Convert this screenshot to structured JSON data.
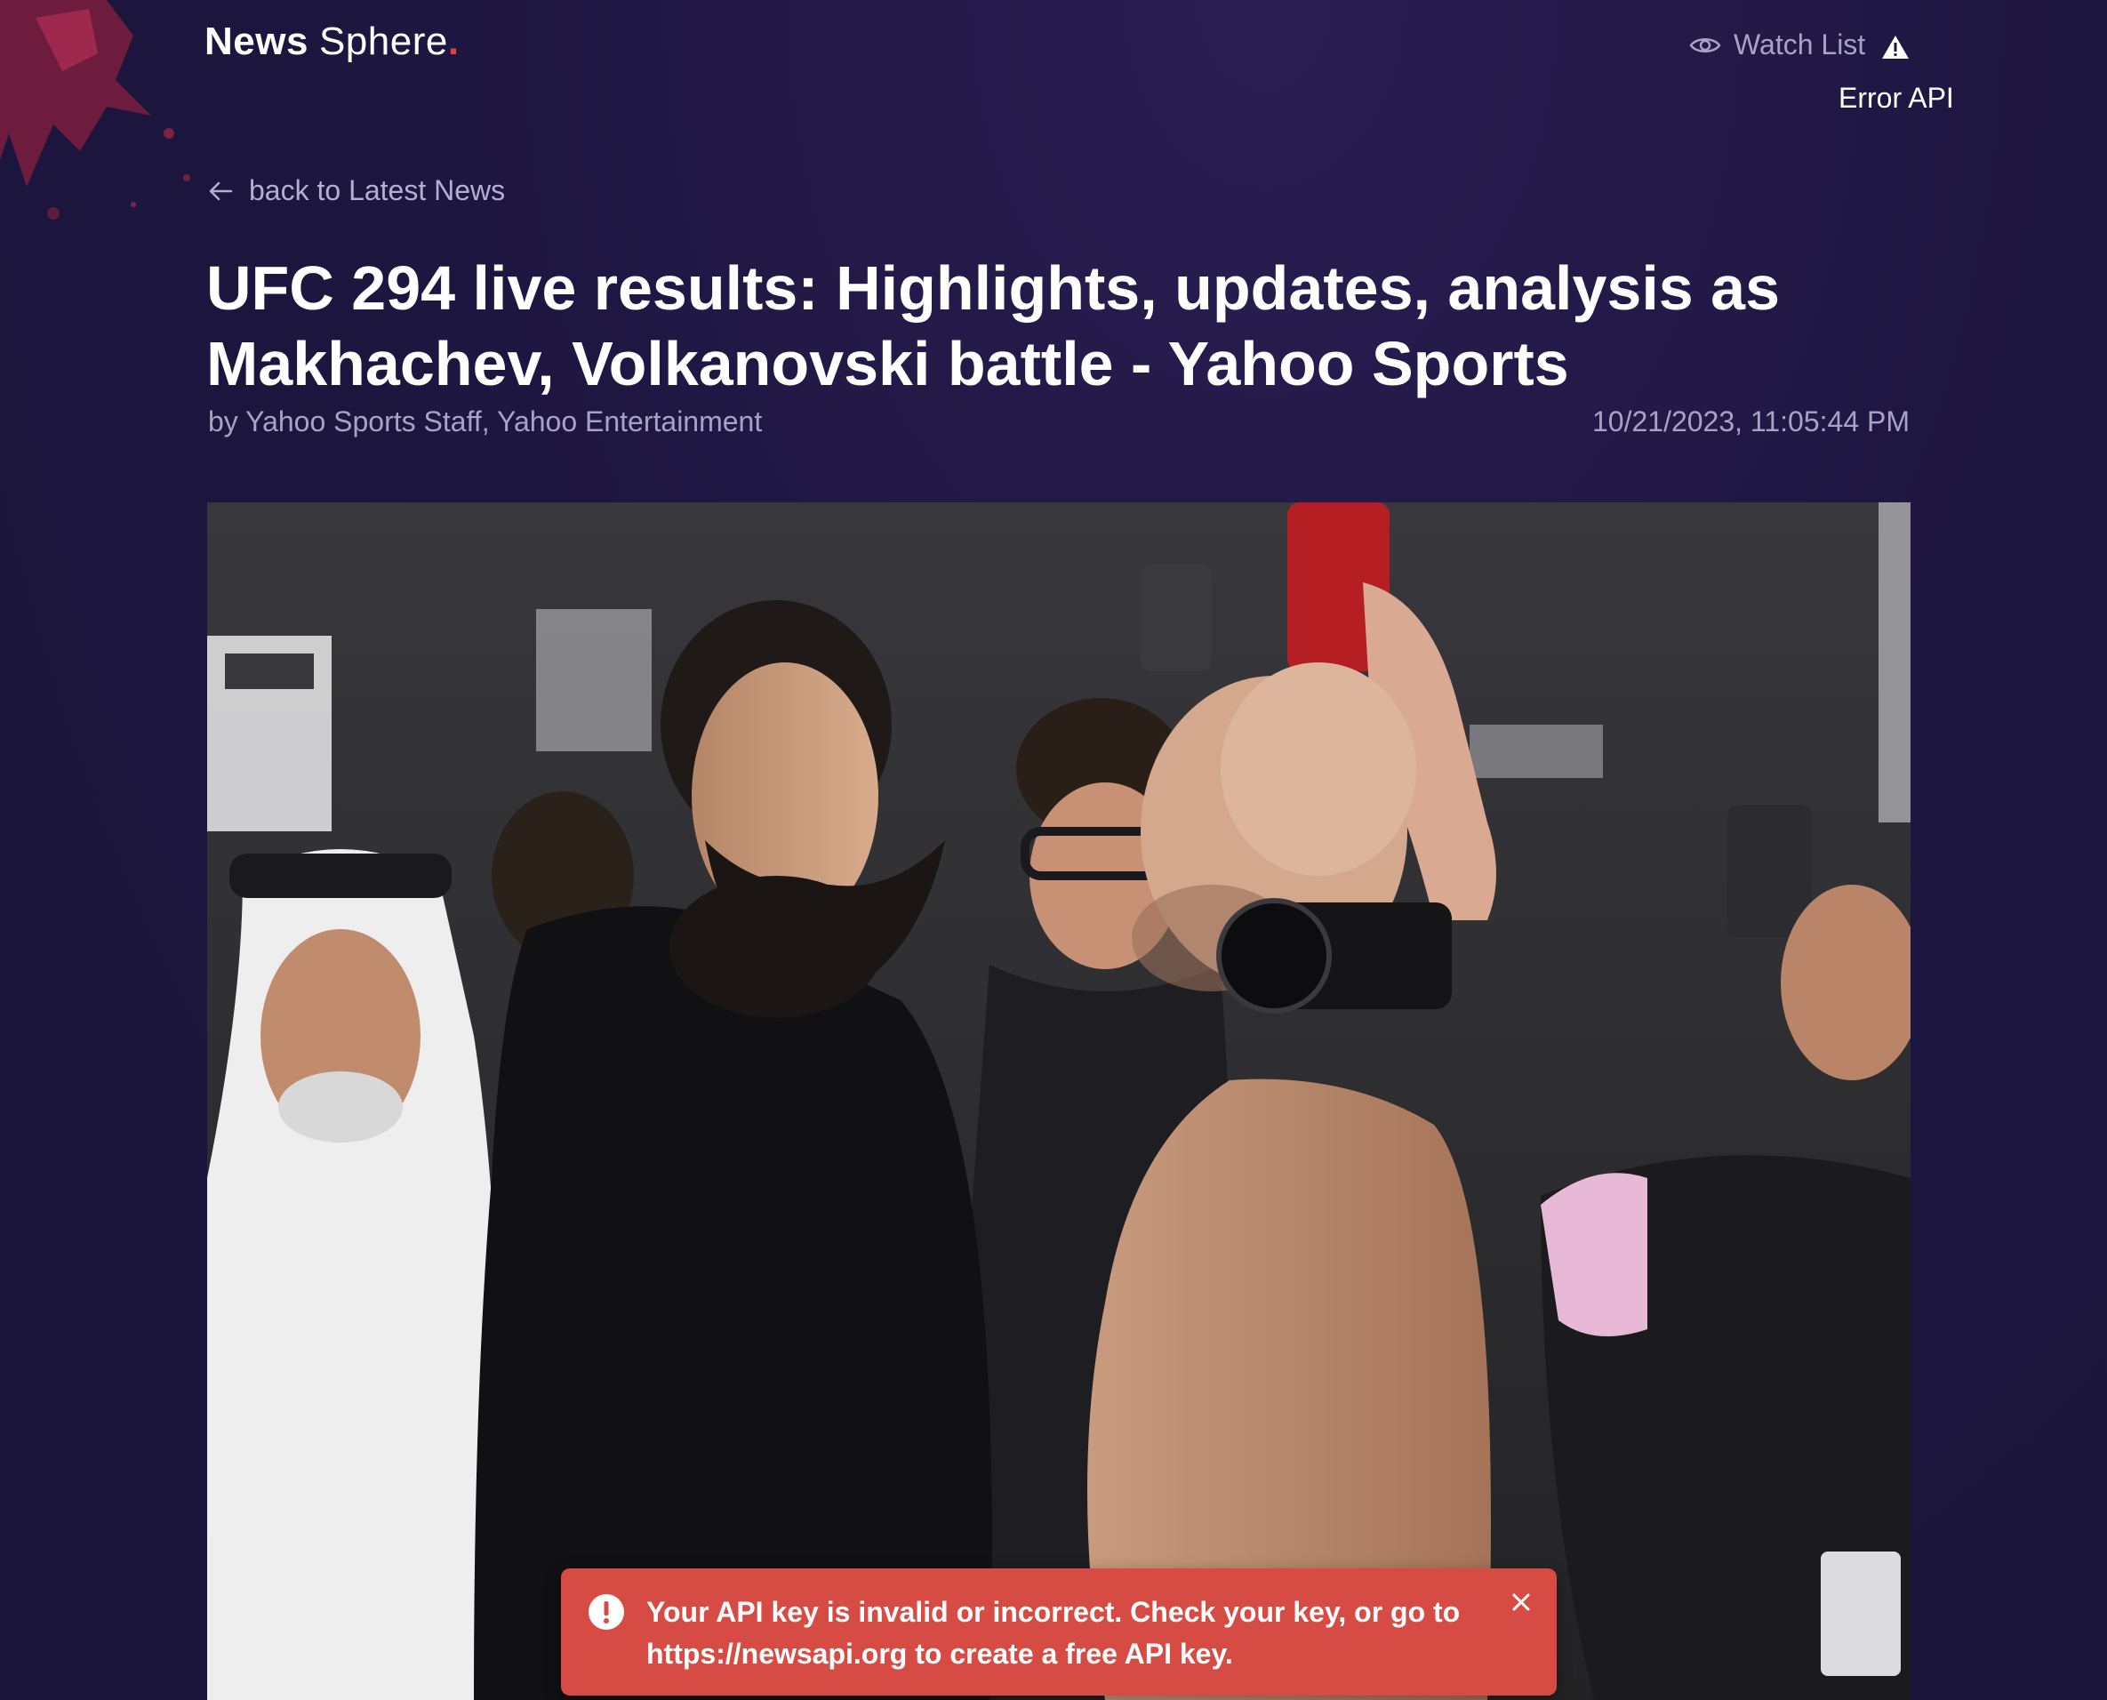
{
  "header": {
    "logo_bold": "News",
    "logo_light": "Sphere",
    "logo_dot": ".",
    "watch_list_label": "Watch List",
    "error_label": "Error API",
    "icons": [
      "eye-icon",
      "warning-icon"
    ]
  },
  "nav": {
    "back_label": "back to Latest News",
    "back_icon": "arrow-left-icon"
  },
  "article": {
    "title": "UFC 294 live results: Highlights, updates, analysis as Makhachev, Volkanovski battle - Yahoo Sports",
    "byline": "by Yahoo Sports Staff, Yahoo Entertainment",
    "date": "10/21/2023, 11:05:44 PM"
  },
  "toast": {
    "message": "Your API key is invalid or incorrect. Check your key, or go to https://newsapi.org to create a free API key.",
    "icon": "error-circle-icon",
    "close_icon": "close-icon"
  },
  "colors": {
    "background": "#1d1640",
    "muted_text": "#a8a2c6",
    "accent_dot": "#e0424a",
    "toast": "#d64c45"
  }
}
